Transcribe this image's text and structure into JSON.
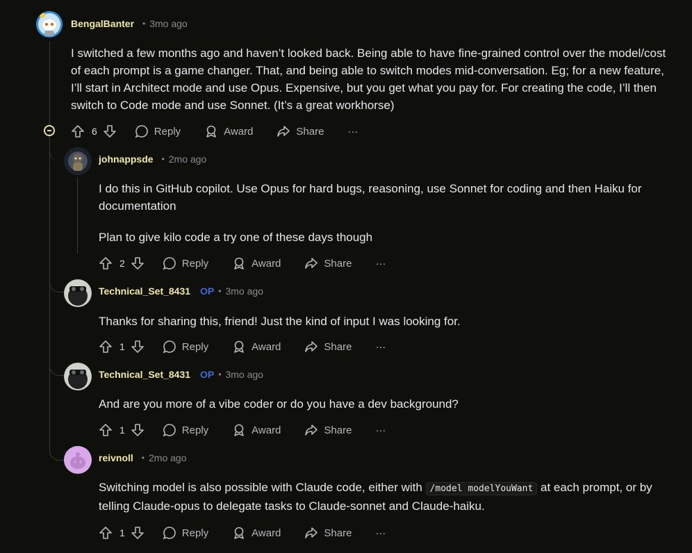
{
  "comments": [
    {
      "author": "BengalBanter",
      "op": "",
      "time": "3mo ago",
      "body": [
        "I switched a few months ago and haven’t looked back. Being able to have fine-grained control over the model/cost of each prompt is a game changer. That, and being able to switch modes mid-conversation. Eg; for a new feature, I’ll start in Architect mode and use Opus. Expensive, but you get what you pay for. For creating the code, I’ll then switch to Code mode and use Sonnet. (It’s a great workhorse)"
      ],
      "votes": "6"
    },
    {
      "author": "johnappsde",
      "op": "",
      "time": "2mo ago",
      "body": [
        "I do this in GitHub copilot. Use Opus for hard bugs, reasoning, use Sonnet for coding and then Haiku for documentation",
        "Plan to give kilo code a try one of these days though"
      ],
      "votes": "2"
    },
    {
      "author": "Technical_Set_8431",
      "op": "OP",
      "time": "3mo ago",
      "body": [
        "Thanks for sharing this, friend! Just the kind of input I was looking for."
      ],
      "votes": "1"
    },
    {
      "author": "Technical_Set_8431",
      "op": "OP",
      "time": "3mo ago",
      "body": [
        "And are you more of a vibe coder or do you have a dev background?"
      ],
      "votes": "1"
    },
    {
      "author": "reivnoll",
      "op": "",
      "time": "2mo ago",
      "body_parts": {
        "before": "Switching model is also possible with Claude code, either with ",
        "code": "/model modelYouWant",
        "after": " at each prompt, or by telling Claude-opus to delegate tasks to Claude-sonnet and Claude-haiku."
      },
      "votes": "1"
    }
  ],
  "actions": {
    "reply": "Reply",
    "award": "Award",
    "share": "Share",
    "more": "···"
  },
  "colors": {
    "background": "#0f0f0b",
    "author": "#f2e8a8",
    "op_badge": "#3d6bd9",
    "muted": "#8a8d8f"
  }
}
